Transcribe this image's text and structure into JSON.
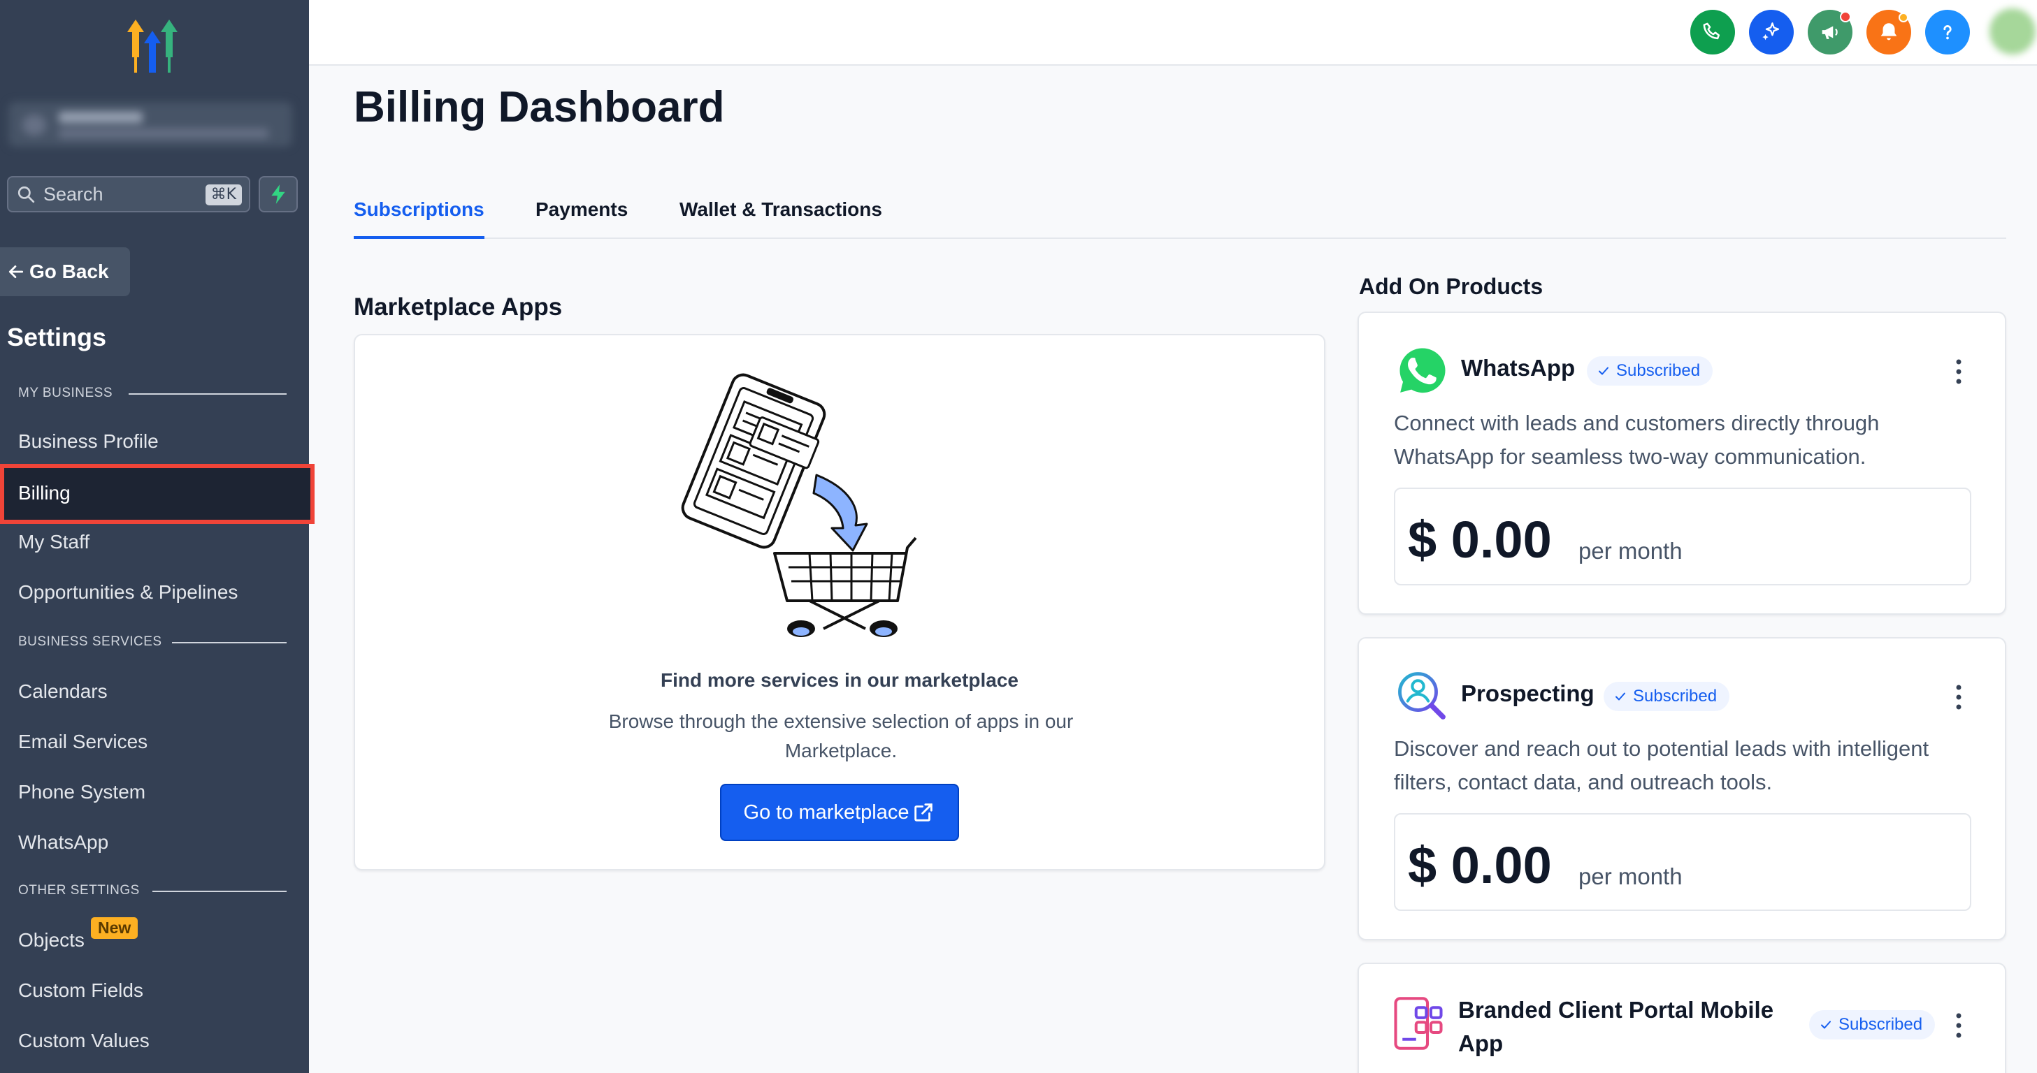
{
  "sidebar": {
    "search_placeholder": "Search",
    "search_shortcut": "⌘K",
    "go_back": "Go Back",
    "settings_title": "Settings",
    "sections": {
      "my_business": "MY BUSINESS",
      "business_services": "BUSINESS SERVICES",
      "other_settings": "OTHER SETTINGS"
    },
    "items": {
      "business_profile": "Business Profile",
      "billing": "Billing",
      "my_staff": "My Staff",
      "opportunities": "Opportunities & Pipelines",
      "calendars": "Calendars",
      "email_services": "Email Services",
      "phone_system": "Phone System",
      "whatsapp": "WhatsApp",
      "objects": "Objects",
      "objects_badge": "New",
      "custom_fields": "Custom Fields",
      "custom_values": "Custom Values"
    }
  },
  "topbar": {
    "icons": [
      "phone-icon",
      "ai-sparkle-icon",
      "announcement-icon",
      "notification-bell-icon",
      "help-icon"
    ],
    "colors": {
      "phone": "#0e9f4f",
      "ai": "#155eef",
      "announce": "#3f9a6a",
      "bell": "#f97316",
      "help": "#1e90ff"
    }
  },
  "page": {
    "title": "Billing Dashboard",
    "tabs": [
      "Subscriptions",
      "Payments",
      "Wallet & Transactions"
    ],
    "active_tab": "Subscriptions"
  },
  "marketplace": {
    "section_title": "Marketplace Apps",
    "heading": "Find more services in our marketplace",
    "description": "Browse through the extensive selection of apps in our Marketplace.",
    "button": "Go to marketplace"
  },
  "addons": {
    "section_title": "Add On Products",
    "items": [
      {
        "name": "WhatsApp",
        "status": "Subscribed",
        "description": "Connect with leads and customers directly through WhatsApp for seamless two-way communication.",
        "price": "$ 0.00",
        "period": "per month"
      },
      {
        "name": "Prospecting",
        "status": "Subscribed",
        "description": "Discover and reach out to potential leads with intelligent filters, contact data, and outreach tools.",
        "price": "$ 0.00",
        "period": "per month"
      },
      {
        "name_line1": "Branded Client Portal Mobile",
        "name_line2": "App",
        "status": "Subscribed"
      }
    ]
  },
  "colors": {
    "accent": "#155eef",
    "sidebar": "#344054",
    "highlight": "#f04438"
  }
}
